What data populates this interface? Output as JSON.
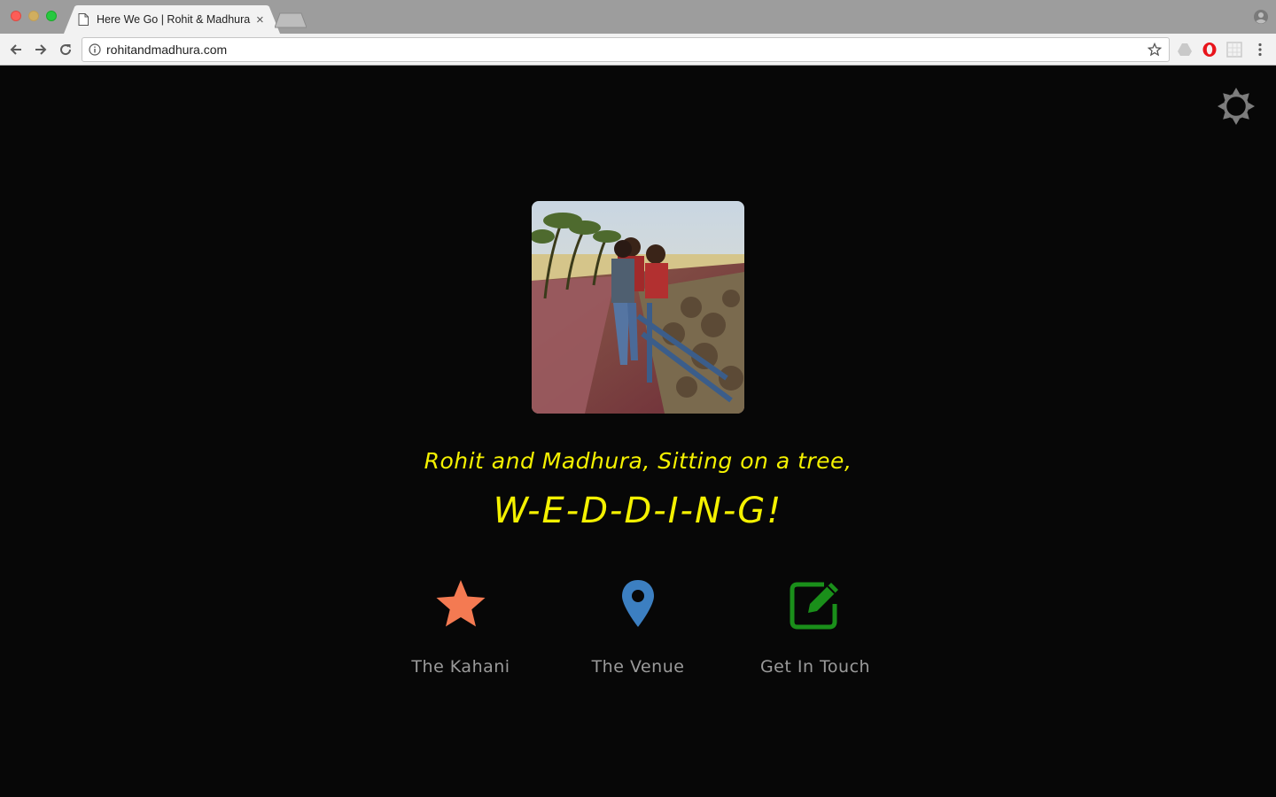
{
  "browser": {
    "tab_title": "Here We Go | Rohit & Madhura",
    "tab_close": "×",
    "url": "rohitandmadhura.com"
  },
  "page": {
    "headline": "Rohit and Madhura, Sitting on a tree,",
    "subline": "W-E-D-D-I-N-G!",
    "nav": [
      {
        "label": "The Kahani",
        "icon": "star-icon",
        "color": "#f47a52"
      },
      {
        "label": "The Venue",
        "icon": "map-pin-icon",
        "color": "#3c7fc1"
      },
      {
        "label": "Get In Touch",
        "icon": "edit-icon",
        "color": "#1a8f1a"
      }
    ],
    "text_color": "#f4f100",
    "label_color": "#9a9a9a",
    "background": "#070707"
  }
}
